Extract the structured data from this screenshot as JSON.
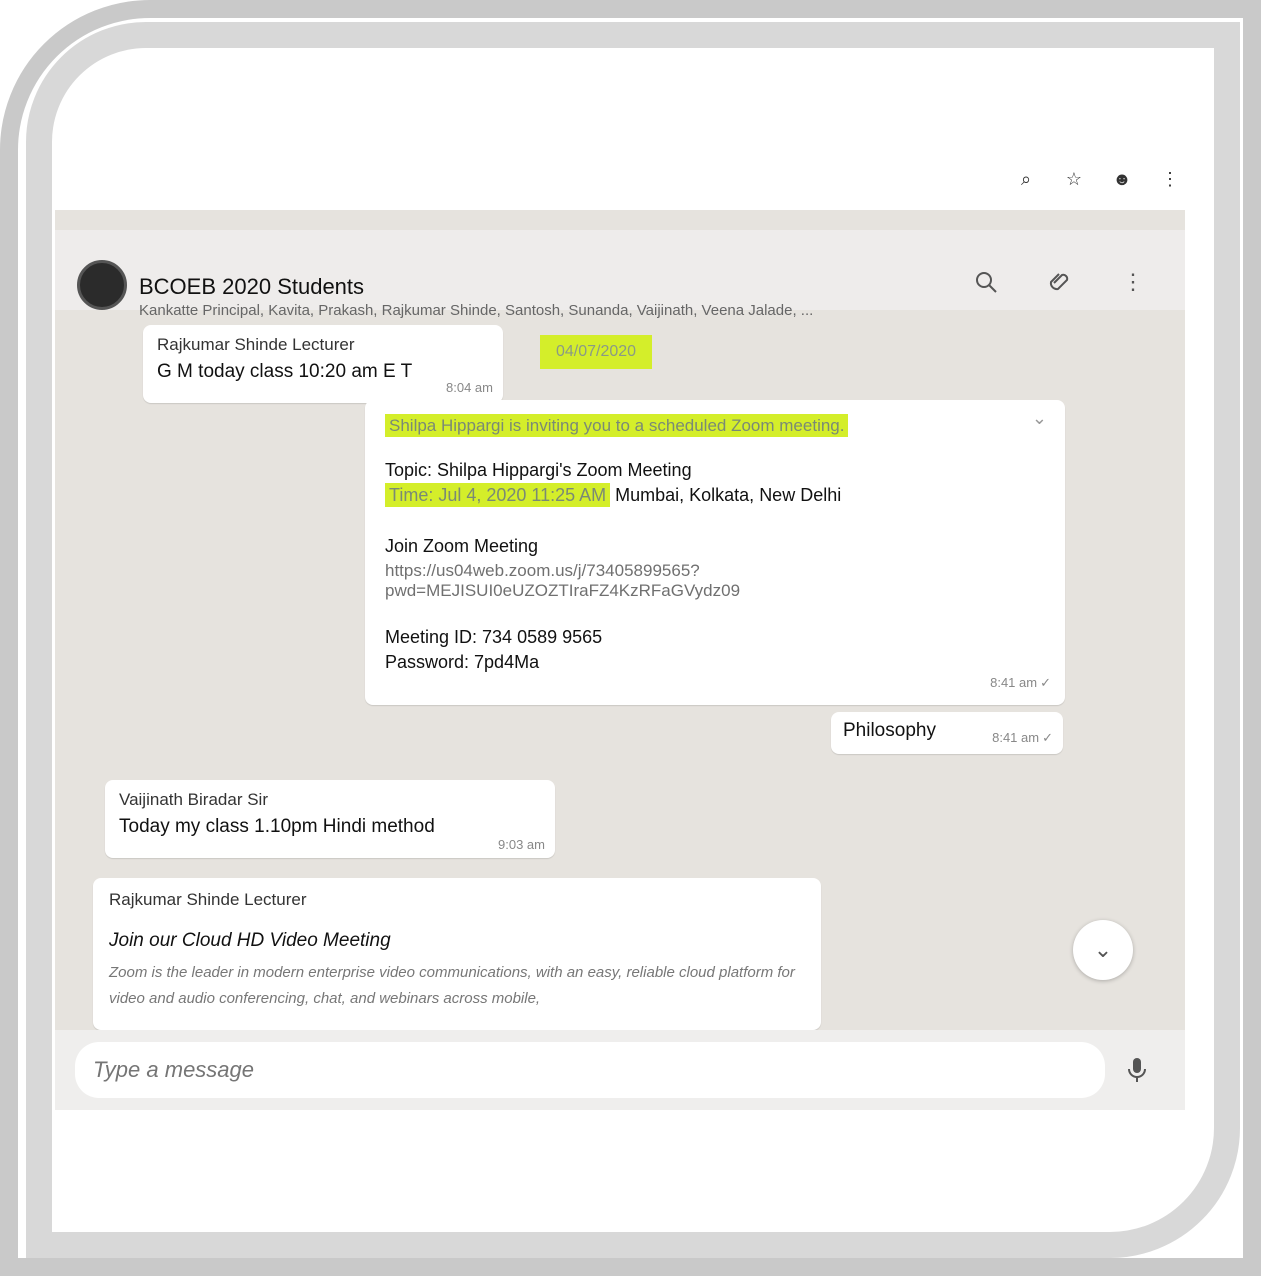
{
  "header": {
    "title": "BCOEB 2020 Students",
    "members": "Kankatte Principal, Kavita, Prakash, Rajkumar Shinde, Santosh, Sunanda, Vaijinath, Veena Jalade, ..."
  },
  "date_label": "04/07/2020",
  "zoom": {
    "invite": "Shilpa Hippargi is inviting you to a scheduled Zoom meeting.",
    "topic": "Topic: Shilpa Hippargi's Zoom Meeting",
    "time": "Time: Jul 4, 2020 11:25 AM",
    "timezone": " Mumbai, Kolkata, New Delhi",
    "join_label": "Join Zoom Meeting",
    "link_1": "https://us04web.zoom.us/j/73405899565?",
    "link_2": "pwd=MEJISUI0eUZOZTIraFZ4KzRFaGVydz09",
    "meeting_id": "Meeting ID: 734 0589 9565",
    "password": "Password: 7pd4Ma",
    "sent_time": "8:41 am"
  },
  "messages": [
    {
      "sender": "Rajkumar Shinde Lecturer",
      "text": "G M  today class 10:20 am E T",
      "time": "8:04 am"
    },
    {
      "text": "Philosophy",
      "time": "8:41 am"
    },
    {
      "sender": "Vaijinath Biradar Sir",
      "text": "Today my class 1.10pm Hindi method",
      "time": "9:03 am"
    },
    {
      "sender": "Rajkumar Shinde Lecturer",
      "preview_title": "Join our Cloud HD Video Meeting",
      "preview_text": "Zoom is the leader in modern enterprise video communications, with an easy, reliable cloud platform for video and audio conferencing, chat, and webinars across mobile,"
    }
  ],
  "composer": {
    "placeholder": "Type a message"
  }
}
